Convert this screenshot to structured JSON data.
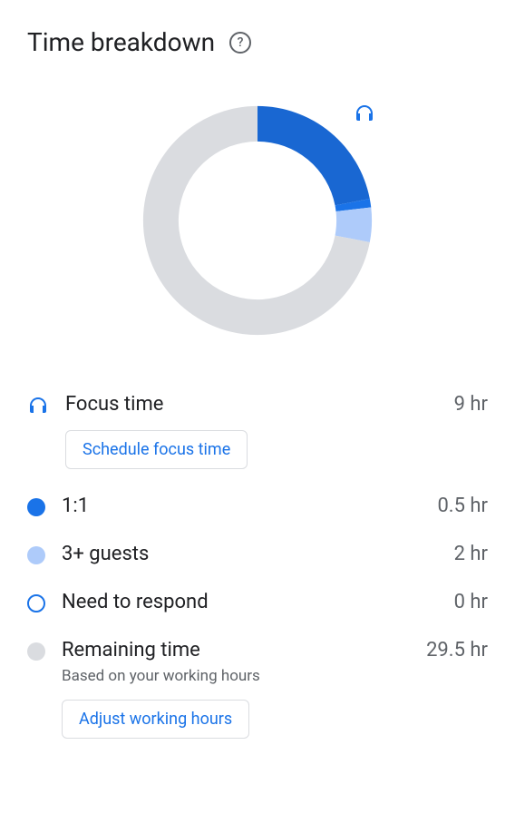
{
  "title": "Time breakdown",
  "chart_data": {
    "type": "pie",
    "title": "Time breakdown",
    "series": [
      {
        "name": "Focus time",
        "value": 9,
        "color": "#1967d2"
      },
      {
        "name": "1:1",
        "value": 0.5,
        "color": "#1a73e8"
      },
      {
        "name": "3+ guests",
        "value": 2,
        "color": "#aecbfa"
      },
      {
        "name": "Need to respond",
        "value": 0,
        "color": "#1a73e8"
      },
      {
        "name": "Remaining time",
        "value": 29.5,
        "color": "#dadce0"
      }
    ],
    "total": 41,
    "unit": "hr"
  },
  "legend": {
    "items": [
      {
        "label": "Focus time",
        "value": "9 hr",
        "icon": "headphones",
        "color": "#1a73e8",
        "action": "Schedule focus time"
      },
      {
        "label": "1:1",
        "value": "0.5 hr",
        "icon": "dot",
        "color": "#1a73e8"
      },
      {
        "label": "3+ guests",
        "value": "2 hr",
        "icon": "dot",
        "color": "#aecbfa"
      },
      {
        "label": "Need to respond",
        "value": "0 hr",
        "icon": "ring",
        "color": "#1a73e8"
      },
      {
        "label": "Remaining time",
        "value": "29.5 hr",
        "icon": "dot",
        "color": "#dadce0",
        "subtitle": "Based on your working hours",
        "action": "Adjust working hours"
      }
    ]
  }
}
